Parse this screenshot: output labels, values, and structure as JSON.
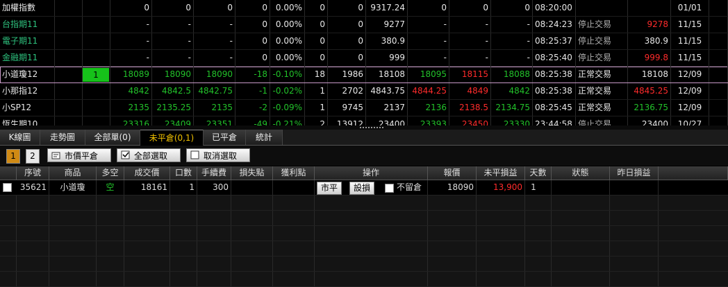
{
  "quotes": [
    {
      "name": "加權指數",
      "cells": [
        "0",
        "0",
        "0",
        "0",
        "0.00%",
        "0",
        "0",
        "9317.24",
        "0",
        "0",
        "0",
        "08:20:00",
        "",
        "",
        "01/01"
      ]
    },
    {
      "name": "台指期11",
      "cells": [
        "-",
        "-",
        "-",
        "0",
        "0.00%",
        "0",
        "0",
        "9277",
        "-",
        "-",
        "-",
        "08:24:23",
        "停止交易",
        "9278",
        "11/15"
      ]
    },
    {
      "name": "電子期11",
      "cells": [
        "-",
        "-",
        "-",
        "0",
        "0.00%",
        "0",
        "0",
        "380.9",
        "-",
        "-",
        "-",
        "08:25:37",
        "停止交易",
        "380.9",
        "11/15"
      ]
    },
    {
      "name": "金融期11",
      "cells": [
        "-",
        "-",
        "-",
        "0",
        "0.00%",
        "0",
        "0",
        "999",
        "-",
        "-",
        "-",
        "08:25:40",
        "停止交易",
        "999.8",
        "11/15"
      ]
    },
    {
      "name": "小道瓊12",
      "badge": "1",
      "cells": [
        "18089",
        "18090",
        "18090",
        "-18",
        "-0.10%",
        "18",
        "1986",
        "18108",
        "18095",
        "18115",
        "18088",
        "08:25:38",
        "正常交易",
        "18108",
        "12/09"
      ]
    },
    {
      "name": "小那指12",
      "cells": [
        "4842",
        "4842.5",
        "4842.75",
        "-1",
        "-0.02%",
        "1",
        "2702",
        "4843.75",
        "4844.25",
        "4849",
        "4842",
        "08:25:38",
        "正常交易",
        "4845.25",
        "12/09"
      ]
    },
    {
      "name": "小SP12",
      "cells": [
        "2135",
        "2135.25",
        "2135",
        "-2",
        "-0.09%",
        "1",
        "9745",
        "2137",
        "2136",
        "2138.5",
        "2134.75",
        "08:25:45",
        "正常交易",
        "2136.75",
        "12/09"
      ]
    },
    {
      "name": "恆生期10",
      "cells": [
        "23316",
        "23409",
        "23351",
        "-49",
        "-0.21%",
        "2",
        "13912",
        "23400",
        "23393",
        "23450",
        "23330",
        "23:44:58",
        "停止交易",
        "23400",
        "10/27"
      ]
    }
  ],
  "tabs": [
    "K線圖",
    "走勢圖",
    "全部單(0)",
    "未平倉(0,1)",
    "已平倉",
    "統計"
  ],
  "toolbar": {
    "page1": "1",
    "page2": "2",
    "market_close": "市價平倉",
    "select_all": "全部選取",
    "deselect": "取消選取"
  },
  "grid": {
    "headers": [
      "",
      "序號",
      "商品",
      "多空",
      "成交價",
      "口數",
      "手續費",
      "損失點",
      "獲利點",
      "操作",
      "報價",
      "未平損益",
      "天數",
      "狀態",
      "昨日損益"
    ],
    "row": {
      "serial": "35621",
      "product": "小道瓊",
      "side": "空",
      "price": "18161",
      "qty": "1",
      "fee": "300",
      "close_btn": "市平",
      "set_loss_btn": "設損",
      "no_keep_label": "不留倉",
      "quote": "18090",
      "pnl": "13,900",
      "days": "1"
    }
  },
  "colors": {
    "up": "#22c22a",
    "down": "#ff2b2b",
    "accent": "#f0c000",
    "badge": "#16c21a"
  }
}
